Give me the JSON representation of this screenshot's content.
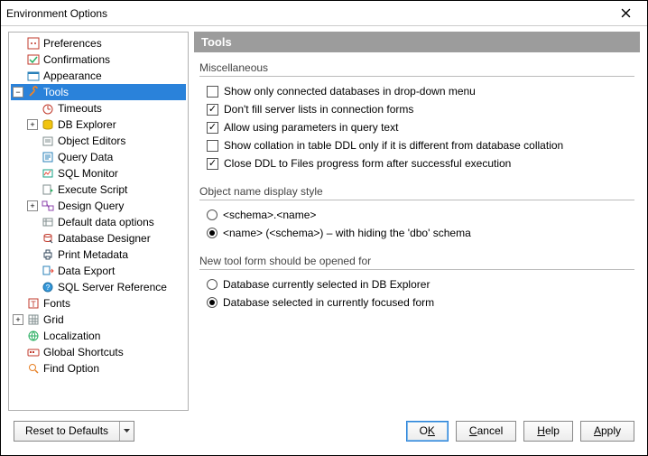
{
  "title": "Environment Options",
  "tree": {
    "preferences": "Preferences",
    "confirmations": "Confirmations",
    "appearance": "Appearance",
    "tools": "Tools",
    "timeouts": "Timeouts",
    "db_explorer": "DB Explorer",
    "object_editors": "Object Editors",
    "query_data": "Query Data",
    "sql_monitor": "SQL Monitor",
    "execute_script": "Execute Script",
    "design_query": "Design Query",
    "default_data_options": "Default data options",
    "database_designer": "Database Designer",
    "print_metadata": "Print Metadata",
    "data_export": "Data Export",
    "sql_server_reference": "SQL Server Reference",
    "fonts": "Fonts",
    "grid": "Grid",
    "localization": "Localization",
    "global_shortcuts": "Global Shortcuts",
    "find_option": "Find Option"
  },
  "panel": {
    "title": "Tools",
    "misc": {
      "title": "Miscellaneous",
      "opt1": "Show only connected databases in drop-down menu",
      "opt2": "Don't fill server lists in connection forms",
      "opt3": "Allow using parameters in query text",
      "opt4": "Show collation in table DDL only if it is different from database collation",
      "opt5": "Close DDL to Files progress form after successful execution"
    },
    "display_style": {
      "title": "Object name display style",
      "opt1": "<schema>.<name>",
      "opt2": "<name> (<schema>) – with hiding the 'dbo' schema"
    },
    "new_tool": {
      "title": "New tool form should be opened for",
      "opt1": "Database currently selected in DB Explorer",
      "opt2": "Database selected in currently focused form"
    }
  },
  "buttons": {
    "reset": "Reset to Defaults",
    "ok_pre": "O",
    "ok_u": "K",
    "cancel_u": "C",
    "cancel_post": "ancel",
    "help_u": "H",
    "help_post": "elp",
    "apply_u": "A",
    "apply_post": "pply"
  }
}
